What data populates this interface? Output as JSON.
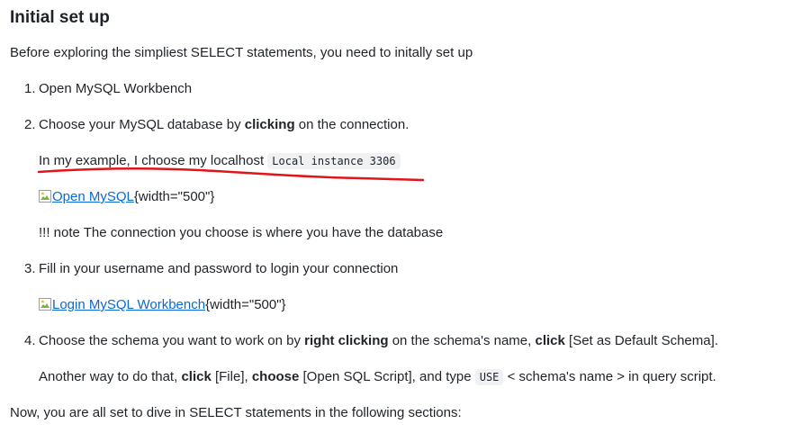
{
  "heading": "Initial set up",
  "intro": "Before exploring the simpliest SELECT statements, you need to initally set up",
  "steps": [
    {
      "num": "1.",
      "text": "Open MySQL Workbench"
    },
    {
      "num": "2.",
      "pre": "Choose your MySQL database by ",
      "bold": "clicking",
      "post": " on the connection.",
      "example_text": "In my example, I choose my localhost ",
      "example_code": "Local instance 3306",
      "image_alt": "Open MySQL",
      "image_attr": "{width=\"500\"}",
      "note": "!!! note The connection you choose is where you have the database"
    },
    {
      "num": "3.",
      "text": "Fill in your username and password to login your connection",
      "image_alt": "Login MySQL Workbench",
      "image_attr": "{width=\"500\"}"
    },
    {
      "num": "4.",
      "pre": "Choose the schema you want to work on by ",
      "bold1": "right clicking",
      "mid": " on the schema's name, ",
      "bold2": "click",
      "post": " [Set as Default Schema].",
      "alt_pre": "Another way to do that, ",
      "alt_bold1": "click",
      "alt_mid1": " [File], ",
      "alt_bold2": "choose",
      "alt_mid2": " [Open SQL Script], and type ",
      "alt_code": "USE",
      "alt_post": " < schema's name > in query script."
    }
  ],
  "outro": "Now, you are all set to dive in SELECT statements in the following sections:",
  "annotation_color": "#e0151a"
}
